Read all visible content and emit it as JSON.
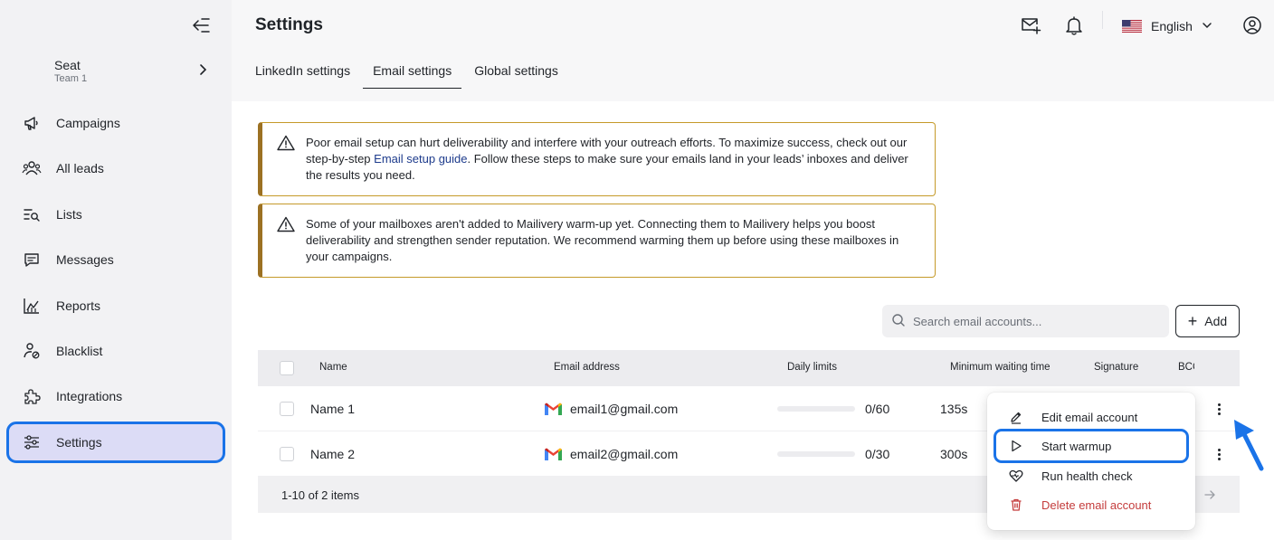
{
  "sidebar": {
    "seat": {
      "name": "Seat",
      "team": "Team 1"
    },
    "items": [
      {
        "label": "Campaigns",
        "icon": "megaphone-icon"
      },
      {
        "label": "All leads",
        "icon": "users-icon"
      },
      {
        "label": "Lists",
        "icon": "list-search-icon"
      },
      {
        "label": "Messages",
        "icon": "message-icon"
      },
      {
        "label": "Reports",
        "icon": "chart-icon"
      },
      {
        "label": "Blacklist",
        "icon": "user-blocked-icon"
      },
      {
        "label": "Integrations",
        "icon": "puzzle-icon"
      },
      {
        "label": "Settings",
        "icon": "sliders-icon",
        "active": true
      }
    ]
  },
  "header": {
    "title": "Settings",
    "language": "English",
    "icons": [
      "mail-plus-icon",
      "bell-icon",
      "us-flag-icon",
      "chevron-down-icon",
      "user-circle-icon"
    ]
  },
  "tabs": [
    {
      "label": "LinkedIn settings"
    },
    {
      "label": "Email settings",
      "active": true
    },
    {
      "label": "Global settings"
    }
  ],
  "alerts": {
    "a1_before": "Poor email setup can hurt deliverability and interfere with your outreach efforts. To maximize success, check out our step-by-step ",
    "a1_link": "Email setup guide",
    "a1_after": ". Follow these steps to make sure your emails land in your leads’ inboxes and deliver the results you need.",
    "a2": "Some of your mailboxes aren't added to Mailivery warm-up yet. Connecting them to Mailivery helps you boost deliverability and strengthen sender reputation. We recommend warming them up before using these mailboxes in your campaigns."
  },
  "search": {
    "placeholder": "Search email accounts..."
  },
  "add_label": "Add",
  "table": {
    "columns": [
      "Name",
      "Email address",
      "Daily limits",
      "Minimum waiting time",
      "Signature",
      "BCC"
    ],
    "rows": [
      {
        "name": "Name 1",
        "email": "email1@gmail.com",
        "limit": "0/60",
        "limit_fraction": 0,
        "wait": "135s"
      },
      {
        "name": "Name 2",
        "email": "email2@gmail.com",
        "limit": "0/30",
        "limit_fraction": 0,
        "wait": "300s"
      }
    ],
    "footer": "1-10 of 2 items"
  },
  "menu": {
    "items": [
      {
        "label": "Edit email account",
        "icon": "pencil-icon"
      },
      {
        "label": "Start warmup",
        "icon": "play-icon",
        "highlight": true
      },
      {
        "label": "Run health check",
        "icon": "heart-pulse-icon"
      },
      {
        "label": "Delete email account",
        "icon": "trash-icon",
        "danger": true
      }
    ]
  },
  "colors": {
    "accent": "#1a73e8",
    "active_bg": "#dcdcf6",
    "warning_border": "#c59a2a",
    "danger": "#c43c3c"
  }
}
